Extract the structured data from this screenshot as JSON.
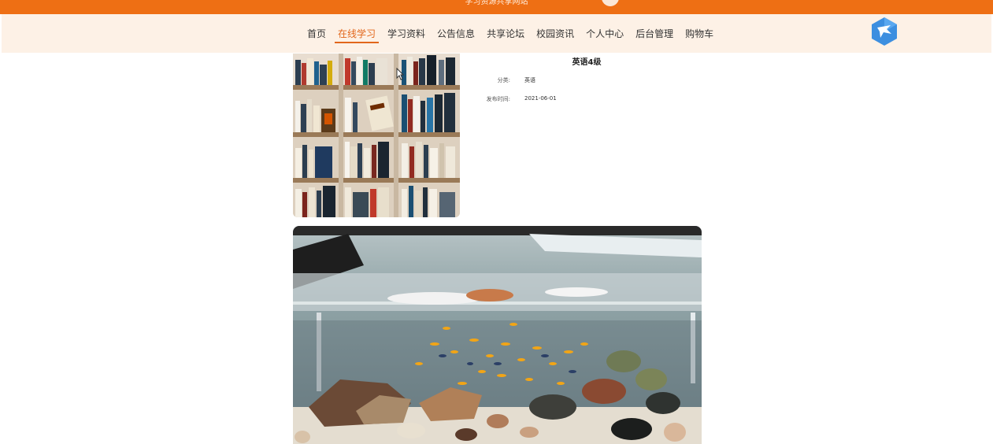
{
  "header": {
    "site_title": "学习资源共享网站"
  },
  "nav": {
    "items": [
      {
        "label": "首页",
        "active": false
      },
      {
        "label": "在线学习",
        "active": true
      },
      {
        "label": "学习资料",
        "active": false
      },
      {
        "label": "公告信息",
        "active": false
      },
      {
        "label": "共享论坛",
        "active": false
      },
      {
        "label": "校园资讯",
        "active": false
      },
      {
        "label": "个人中心",
        "active": false
      },
      {
        "label": "后台管理",
        "active": false
      },
      {
        "label": "购物车",
        "active": false
      }
    ],
    "accent_color": "#e2661b",
    "logo_icon": "bird-hexagon-icon"
  },
  "detail": {
    "title": "英语4级",
    "fields": [
      {
        "label": "分类:",
        "value": "英语"
      },
      {
        "label": "发布时间:",
        "value": "2021-06-01"
      }
    ]
  },
  "images": {
    "cover": "bookshelf-photo",
    "content": "aquarium-photo"
  },
  "colors": {
    "topbar": "#ee6f14",
    "navbar": "#fdf1e6"
  }
}
